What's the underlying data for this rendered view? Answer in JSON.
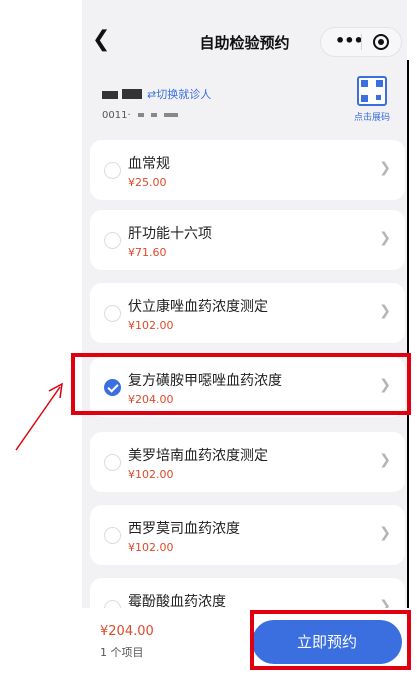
{
  "nav": {
    "back_icon": "chevron-left-icon",
    "title": "自助检验预约",
    "more_icon": "more-dots-icon",
    "close_icon": "target-close-icon"
  },
  "patient": {
    "switch_label": "⇄切换就诊人",
    "id_prefix": "0011·",
    "qr_label": "点击展码"
  },
  "items": [
    {
      "name": "血常规",
      "price": "¥25.00",
      "checked": false
    },
    {
      "name": "肝功能十六项",
      "price": "¥71.60",
      "checked": false
    },
    {
      "name": "伏立康唑血药浓度测定",
      "price": "¥102.00",
      "checked": false
    },
    {
      "name": "复方磺胺甲噁唑血药浓度",
      "price": "¥204.00",
      "checked": true
    },
    {
      "name": "美罗培南血药浓度测定",
      "price": "¥102.00",
      "checked": false
    },
    {
      "name": "西罗莫司血药浓度",
      "price": "¥102.00",
      "checked": false
    },
    {
      "name": "霉酚酸血药浓度",
      "price": "",
      "checked": false
    }
  ],
  "footer": {
    "total": "¥204.00",
    "count": "1  个项目",
    "book_label": "立即预约"
  },
  "annotation_color": "#e0000f",
  "accent_color": "#3b6fe0"
}
